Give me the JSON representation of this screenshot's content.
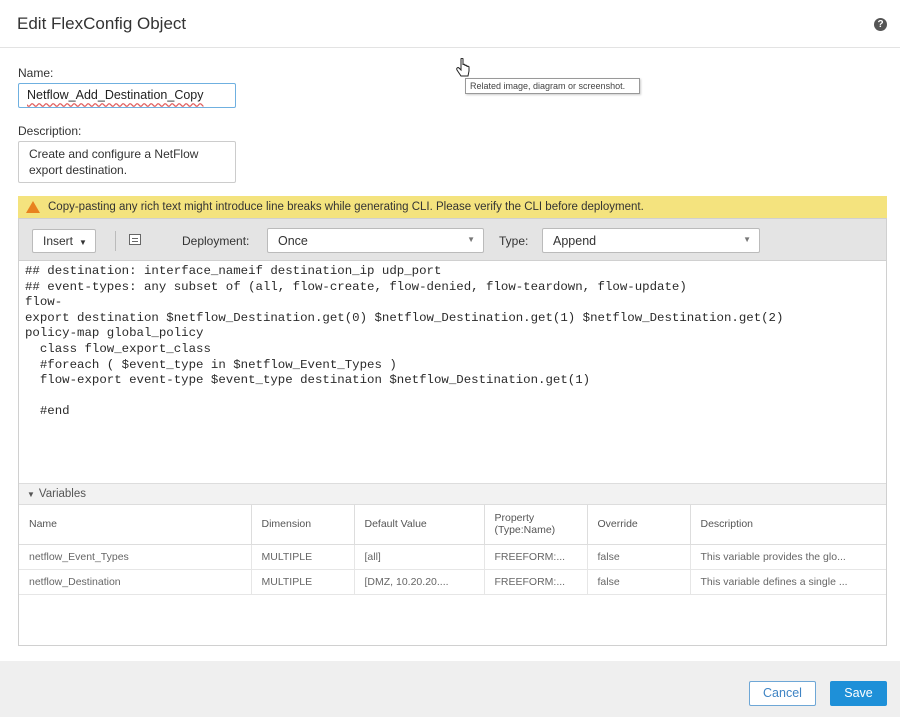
{
  "dialog": {
    "title": "Edit FlexConfig Object",
    "help_icon_text": "?"
  },
  "name": {
    "label": "Name:",
    "value": "Netflow_Add_Destination_Copy"
  },
  "description": {
    "label": "Description:",
    "line1": "Create and configure a NetFlow",
    "line2": "export destination."
  },
  "tooltip": {
    "text": "Related image, diagram or screenshot."
  },
  "warning": {
    "text": "Copy-pasting any rich text might introduce line breaks while generating CLI. Please verify the CLI before deployment.",
    "color": "#f4e37e",
    "icon": "warning-icon"
  },
  "toolbar": {
    "insert_label": "Insert",
    "deployment_label": "Deployment:",
    "deployment_value": "Once",
    "type_label": "Type:",
    "type_value": "Append"
  },
  "code": {
    "text": "## destination: interface_nameif destination_ip udp_port\n## event-types: any subset of (all, flow-create, flow-denied, flow-teardown, flow-update)\nflow-\nexport destination $netflow_Destination.get(0) $netflow_Destination.get(1) $netflow_Destination.get(2)\npolicy-map global_policy\n  class flow_export_class\n  #foreach ( $event_type in $netflow_Event_Types )\n  flow-export event-type $event_type destination $netflow_Destination.get(1)\n\n  #end"
  },
  "variables": {
    "header": "Variables",
    "columns": [
      "Name",
      "Dimension",
      "Default Value",
      "Property (Type:Name)",
      "Override",
      "Description"
    ],
    "rows": [
      [
        "netflow_Event_Types",
        "MULTIPLE",
        "[all]",
        "FREEFORM:...",
        "false",
        "This variable provides the glo..."
      ],
      [
        "netflow_Destination",
        "MULTIPLE",
        "[DMZ, 10.20.20....",
        "FREEFORM:...",
        "false",
        "This variable defines a single ..."
      ]
    ]
  },
  "footer": {
    "cancel_label": "Cancel",
    "save_label": "Save",
    "accent_color": "#1e90d8"
  }
}
